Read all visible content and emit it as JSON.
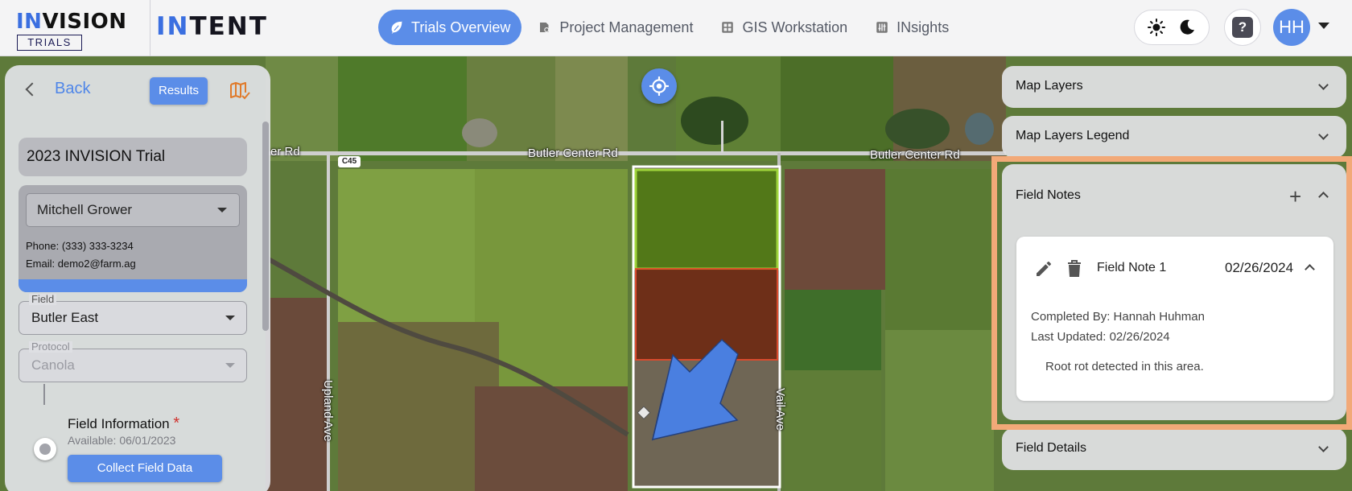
{
  "header": {
    "logo_primary": "INVISION",
    "logo_primary_accent": "IN",
    "logo_primary_rest": "VISION",
    "logo_secondary": "TRIALS",
    "product_accent": "IN",
    "product_rest": "TENT",
    "nav": [
      {
        "label": "Trials Overview",
        "icon": "leaf-icon",
        "active": true
      },
      {
        "label": "Project Management",
        "icon": "project-icon",
        "active": false
      },
      {
        "label": "GIS Workstation",
        "icon": "grid-icon",
        "active": false
      },
      {
        "label": "INsights",
        "icon": "sliders-icon",
        "active": false
      }
    ],
    "help_label": "?",
    "avatar_initials": "HH"
  },
  "map": {
    "roads": {
      "butler_center_left": "Butler Center Rd",
      "butler_center_right": "Butler Center Rd",
      "left_edge": "er Rd",
      "upland": "Upland Ave",
      "vail": "Vail Ave",
      "route_shield": "C45"
    },
    "colors": {
      "plot_top": "#4f7a12",
      "plot_middle": "#6e2a12",
      "plot_outline": "#ffffff",
      "arrow": "#4a7fe0"
    }
  },
  "left_panel": {
    "back_label": "Back",
    "results_label": "Results",
    "trial_name": "2023 INVISION Trial",
    "grower": {
      "name": "Mitchell Grower",
      "phone": "Phone: (333) 333-3234",
      "email": "Email: demo2@farm.ag"
    },
    "field": {
      "legend": "Field",
      "value": "Butler East"
    },
    "protocol": {
      "legend": "Protocol",
      "value": "Canola"
    },
    "step": {
      "title": "Field Information",
      "required_mark": "*",
      "available": "Available: 06/01/2023",
      "button": "Collect Field Data"
    }
  },
  "right_panels": {
    "map_layers": "Map Layers",
    "map_layers_legend": "Map Layers Legend",
    "field_notes": {
      "title": "Field Notes",
      "note": {
        "title": "Field Note 1",
        "date": "02/26/2024",
        "completed_by": "Completed By: Hannah Huhman",
        "last_updated": "Last Updated: 02/26/2024",
        "body": "Root rot detected in this area."
      }
    },
    "field_details": "Field Details"
  },
  "accent_color": "#5b8de8",
  "highlight_color": "#f2a978"
}
